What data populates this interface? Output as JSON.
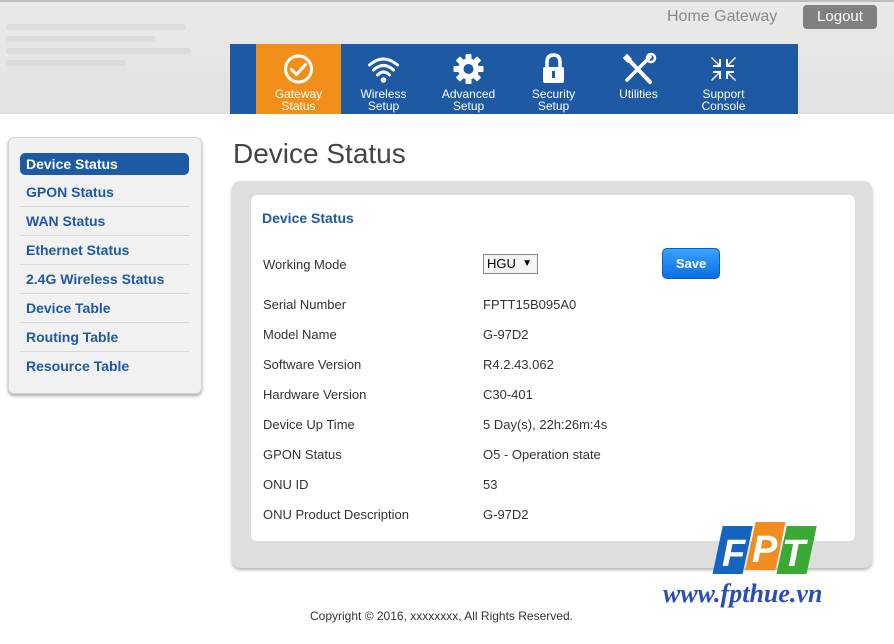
{
  "header": {
    "home_gateway": "Home Gateway",
    "logout_label": "Logout"
  },
  "nav": [
    {
      "label": "Gateway Status",
      "line1": "Gateway",
      "line2": "Status",
      "icon": "check-circle-icon",
      "active": true
    },
    {
      "label": "Wireless Setup",
      "line1": "Wireless",
      "line2": "Setup",
      "icon": "wifi-icon",
      "active": false
    },
    {
      "label": "Advanced Setup",
      "line1": "Advanced",
      "line2": "Setup",
      "icon": "gear-icon",
      "active": false
    },
    {
      "label": "Security Setup",
      "line1": "Security",
      "line2": "Setup",
      "icon": "lock-icon",
      "active": false
    },
    {
      "label": "Utilities",
      "line1": "Utilities",
      "line2": "",
      "icon": "tools-icon",
      "active": false
    },
    {
      "label": "Support Console",
      "line1": "Support",
      "line2": "Console",
      "icon": "compress-arrows-icon",
      "active": false
    }
  ],
  "sidebar": {
    "items": [
      {
        "label": "Device Status",
        "active": true
      },
      {
        "label": "GPON Status"
      },
      {
        "label": "WAN Status"
      },
      {
        "label": "Ethernet Status"
      },
      {
        "label": "2.4G Wireless Status"
      },
      {
        "label": "Device Table"
      },
      {
        "label": "Routing Table"
      },
      {
        "label": "Resource Table"
      }
    ]
  },
  "main": {
    "page_title": "Device Status",
    "card_title": "Device Status",
    "working_mode_label": "Working Mode",
    "working_mode_value": "HGU",
    "save_label": "Save",
    "rows": [
      {
        "label": "Serial Number",
        "value": "FPTT15B095A0"
      },
      {
        "label": "Model Name",
        "value": "G-97D2"
      },
      {
        "label": "Software Version",
        "value": "R4.2.43.062"
      },
      {
        "label": "Hardware Version",
        "value": "C30-401"
      },
      {
        "label": "Device Up Time",
        "value": "5 Day(s), 22h:26m:4s"
      },
      {
        "label": "GPON Status",
        "value": "O5 - Operation state"
      },
      {
        "label": "ONU ID",
        "value": "53"
      },
      {
        "label": "ONU Product Description",
        "value": "G-97D2"
      }
    ]
  },
  "watermark": {
    "logo_text": "FPT",
    "url": "www.fpthue.vn"
  },
  "footer": {
    "copyright": "Copyright © 2016, xxxxxxxx, All Rights Reserved."
  },
  "colors": {
    "nav_blue": "#1d5aa3",
    "nav_active": "#f28f1b",
    "fpt_blue": "#1565c0",
    "fpt_orange": "#f28c1e",
    "fpt_green": "#3aaa35"
  }
}
